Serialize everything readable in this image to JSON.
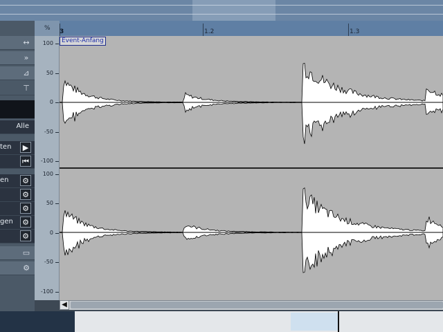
{
  "ruler": {
    "corner_label": "%",
    "start_label": "3",
    "marks": [
      "1.2",
      "1.3"
    ]
  },
  "event_start_label": "Event-Anfang",
  "amplitude_scale": {
    "top_channel": [
      "100",
      "50",
      "0",
      "-50",
      "-100"
    ],
    "bottom_channel": [
      "100",
      "50",
      "0",
      "-50",
      "-100"
    ]
  },
  "inspector": {
    "filter_label": "Alle",
    "rows": [
      {
        "label": "ten"
      },
      {
        "label": "en"
      },
      {
        "label": "gen"
      }
    ]
  },
  "colors": {
    "ruler_bg": "#5f7fa4",
    "wave_bg": "#b4b4b4",
    "waveform_fill": "#ffffff",
    "event_label": "#1a2ba8"
  },
  "icons": {
    "scroll_left": "◀",
    "play": "▶",
    "rewind": "⏮",
    "gear": "⚙"
  }
}
